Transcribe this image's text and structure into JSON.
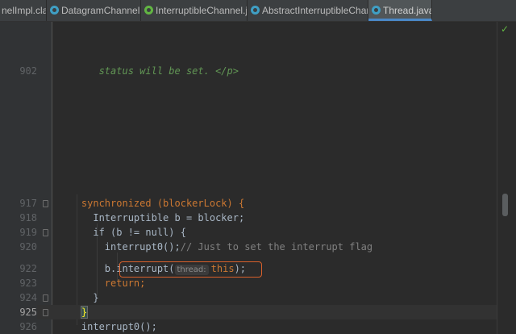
{
  "tabs": [
    {
      "label": "nelImpl.class",
      "icon": "class-file-icon",
      "active": false
    },
    {
      "label": "DatagramChannel.java",
      "icon": "class-icon",
      "active": false
    },
    {
      "label": "InterruptibleChannel.java",
      "icon": "interface-icon",
      "active": false
    },
    {
      "label": "AbstractInterruptibleChannel.java",
      "icon": "class-icon",
      "active": false
    },
    {
      "label": "Thread.java",
      "icon": "class-icon",
      "active": true
    }
  ],
  "close_glyph": "×",
  "status": {
    "check": "✓"
  },
  "lines": {
    "902": "status will be set. </p>",
    "917": "synchronized (blockerLock) {",
    "918": "Interruptible b = blocker;",
    "919": "if (b != null) {",
    "920": "interrupt0();",
    "920_comment": "// Just to set the interrupt flag",
    "922": "b.interrupt(",
    "922_hint": "thread:",
    "922_arg": "this",
    "922_end": ");",
    "923": "return;",
    "924": "}",
    "925": "}",
    "926": "interrupt0();",
    "927": "}"
  }
}
